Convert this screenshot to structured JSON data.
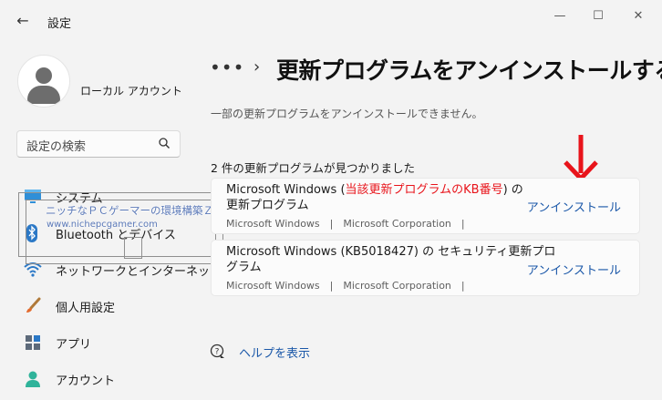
{
  "window": {
    "back_glyph": "←",
    "title": "設定",
    "minimize_glyph": "—",
    "maximize_glyph": "☐",
    "close_glyph": "✕"
  },
  "sidebar": {
    "account_name": "ローカル アカウント",
    "search_placeholder": "設定の検索",
    "items": [
      {
        "label": "システム",
        "icon": "system-icon"
      },
      {
        "label": "Bluetooth とデバイス",
        "icon": "bluetooth-icon"
      },
      {
        "label": "ネットワークとインターネット",
        "icon": "wifi-icon"
      },
      {
        "label": "個人用設定",
        "icon": "brush-icon"
      },
      {
        "label": "アプリ",
        "icon": "apps-icon"
      },
      {
        "label": "アカウント",
        "icon": "person-icon"
      }
    ]
  },
  "main": {
    "breadcrumb_dots": "•••",
    "breadcrumb_sep": "›",
    "title": "更新プログラムをアンインストールする",
    "description": "一部の更新プログラムをアンインストールできません。",
    "found_count": "2 件の更新プログラムが見つかりました",
    "updates": [
      {
        "title_pre": "Microsoft Windows (",
        "title_red": "当該更新プログラムのKB番号",
        "title_post": ") の",
        "title_line2": "更新プログラム",
        "meta": "Microsoft Windows　|　Microsoft Corporation　|",
        "action": "アンインストール"
      },
      {
        "title_line1": "Microsoft Windows (KB5018427) の セキュリティ更新プロ",
        "title_line2": "グラム",
        "meta": "Microsoft Windows　|　Microsoft Corporation　|",
        "action": "アンインストール"
      }
    ],
    "help_label": "ヘルプを表示"
  },
  "watermark": {
    "line1": "ニッチなＰＣゲーマーの環境構築Ｚ",
    "line2": "www.nichepcgamer.com"
  },
  "colors": {
    "accent_link": "#1a57a8",
    "annotation_red": "#e8141b",
    "background": "#f3f3f3",
    "card": "#fbfbfb"
  }
}
